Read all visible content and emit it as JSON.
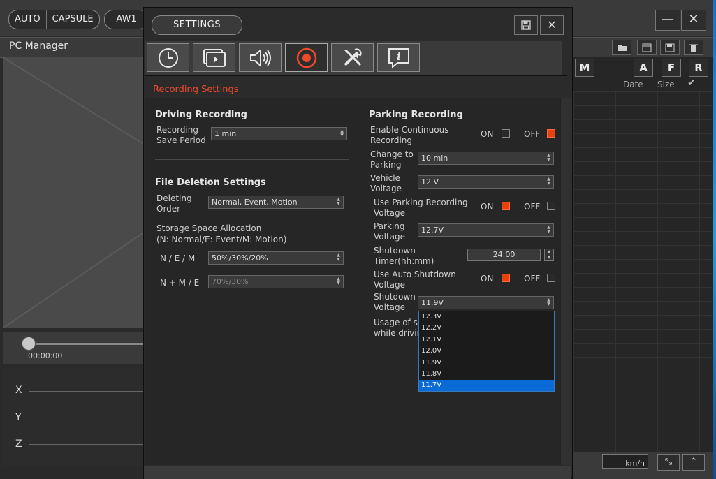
{
  "app": {
    "mode_buttons": [
      "AUTO",
      "CAPSULE"
    ],
    "model_button": "AW1",
    "minimize": "—",
    "close": "✕",
    "pc_manager": "PC Manager",
    "timeline_time": "00:00:00",
    "axes": [
      "X",
      "Y",
      "Z"
    ],
    "filters": [
      "M",
      "A",
      "F",
      "R"
    ],
    "columns": {
      "date": "Date",
      "size": "Size",
      "check": "✔"
    },
    "speed_unit": "km/h"
  },
  "dialog": {
    "title": "SETTINGS",
    "save": "🖫",
    "close": "✕",
    "tabs": [
      "clock-icon",
      "playback-icon",
      "sound-icon",
      "record-icon",
      "tools-icon",
      "info-icon"
    ],
    "active_tab": 3,
    "section_title": "Recording Settings",
    "driving": {
      "heading": "Driving Recording",
      "save_period_label": "Recording\nSave Period",
      "save_period_value": "1 min"
    },
    "deletion": {
      "heading": "File Deletion Settings",
      "order_label": "Deleting\nOrder",
      "order_value": "Normal, Event, Motion",
      "allocation_label": "Storage Space Allocation\n(N: Normal/E: Event/M: Motion)",
      "nem_label": "N / E / M",
      "nem_value": "50%/30%/20%",
      "nmE_label": "N + M / E",
      "nmE_value": "70%/30%"
    },
    "parking": {
      "heading": "Parking Recording",
      "continuous_label": "Enable Continuous\nRecording",
      "on": "ON",
      "off": "OFF",
      "change_label": "Change to\nParking",
      "change_value": "10 min",
      "vehicle_voltage_label": "Vehicle\nVoltage",
      "vehicle_voltage_value": "12 V",
      "use_parking_voltage_label": "Use Parking Recording\nVoltage",
      "parking_voltage_label": "Parking\nVoltage",
      "parking_voltage_value": "12.7V",
      "shutdown_timer_label": "Shutdown\nTimer(hh:mm)",
      "shutdown_timer_value": "24:00",
      "auto_shutdown_label": "Use Auto Shutdown\nVoltage",
      "shutdown_voltage_label": "Shutdown\nVoltage",
      "shutdown_voltage_value": "11.9V",
      "usage_label": "Usage of sh\nwhile drivin",
      "dropdown_options": [
        "12.3V",
        "12.2V",
        "12.1V",
        "12.0V",
        "11.9V",
        "11.8V",
        "11.7V"
      ],
      "dropdown_highlight": "11.7V"
    }
  },
  "colors": {
    "accent": "#ef4a2c",
    "checked": "#e8400e",
    "highlight": "#0a6ad6"
  }
}
